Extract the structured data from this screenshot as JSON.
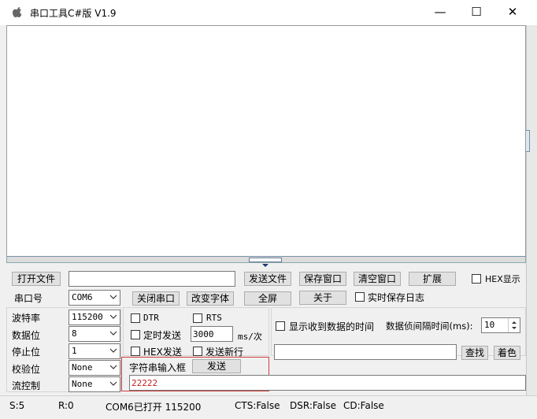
{
  "window": {
    "title": "串口工具C#版  V1.9",
    "icon": "apple-icon",
    "controls": {
      "minimize": "—",
      "maximize": "☐",
      "close": "✕"
    }
  },
  "toolbar1": {
    "open_file": "打开文件",
    "file_path": "",
    "send_file": "发送文件",
    "save_window": "保存窗口",
    "clear_window": "清空窗口",
    "expand": "扩展",
    "hex_display": "HEX显示"
  },
  "toolbar2": {
    "port_label": "串口号",
    "port_value": "COM6",
    "close_port": "关闭串口",
    "change_font": "改变字体",
    "fullscreen": "全屏",
    "about": "关于",
    "realtime_log": "实时保存日志"
  },
  "settings": {
    "baud_label": "波特率",
    "baud_value": "115200",
    "databits_label": "数据位",
    "databits_value": "8",
    "stopbits_label": "停止位",
    "stopbits_value": "1",
    "parity_label": "校验位",
    "parity_value": "None",
    "flow_label": "流控制",
    "flow_value": "None"
  },
  "send_options": {
    "dtr": "DTR",
    "rts": "RTS",
    "timed_send": "定时发送",
    "interval_value": "3000",
    "interval_unit": "ms/次",
    "hex_send": "HEX发送",
    "send_newline": "发送新行"
  },
  "string_input": {
    "label": "字符串输入框",
    "send_button": "发送",
    "value": "22222"
  },
  "display_options": {
    "show_time": "显示收到数据的时间",
    "frame_interval_label": "数据侦间隔时间(ms):",
    "frame_interval_value": "10",
    "search_value": "",
    "find_button": "查找",
    "color_button": "着色"
  },
  "status": {
    "send": "S:5",
    "recv": "R:0",
    "port_status": "COM6已打开  115200",
    "cts": "CTS:False",
    "dsr": "DSR:False",
    "cd": "CD:False"
  }
}
